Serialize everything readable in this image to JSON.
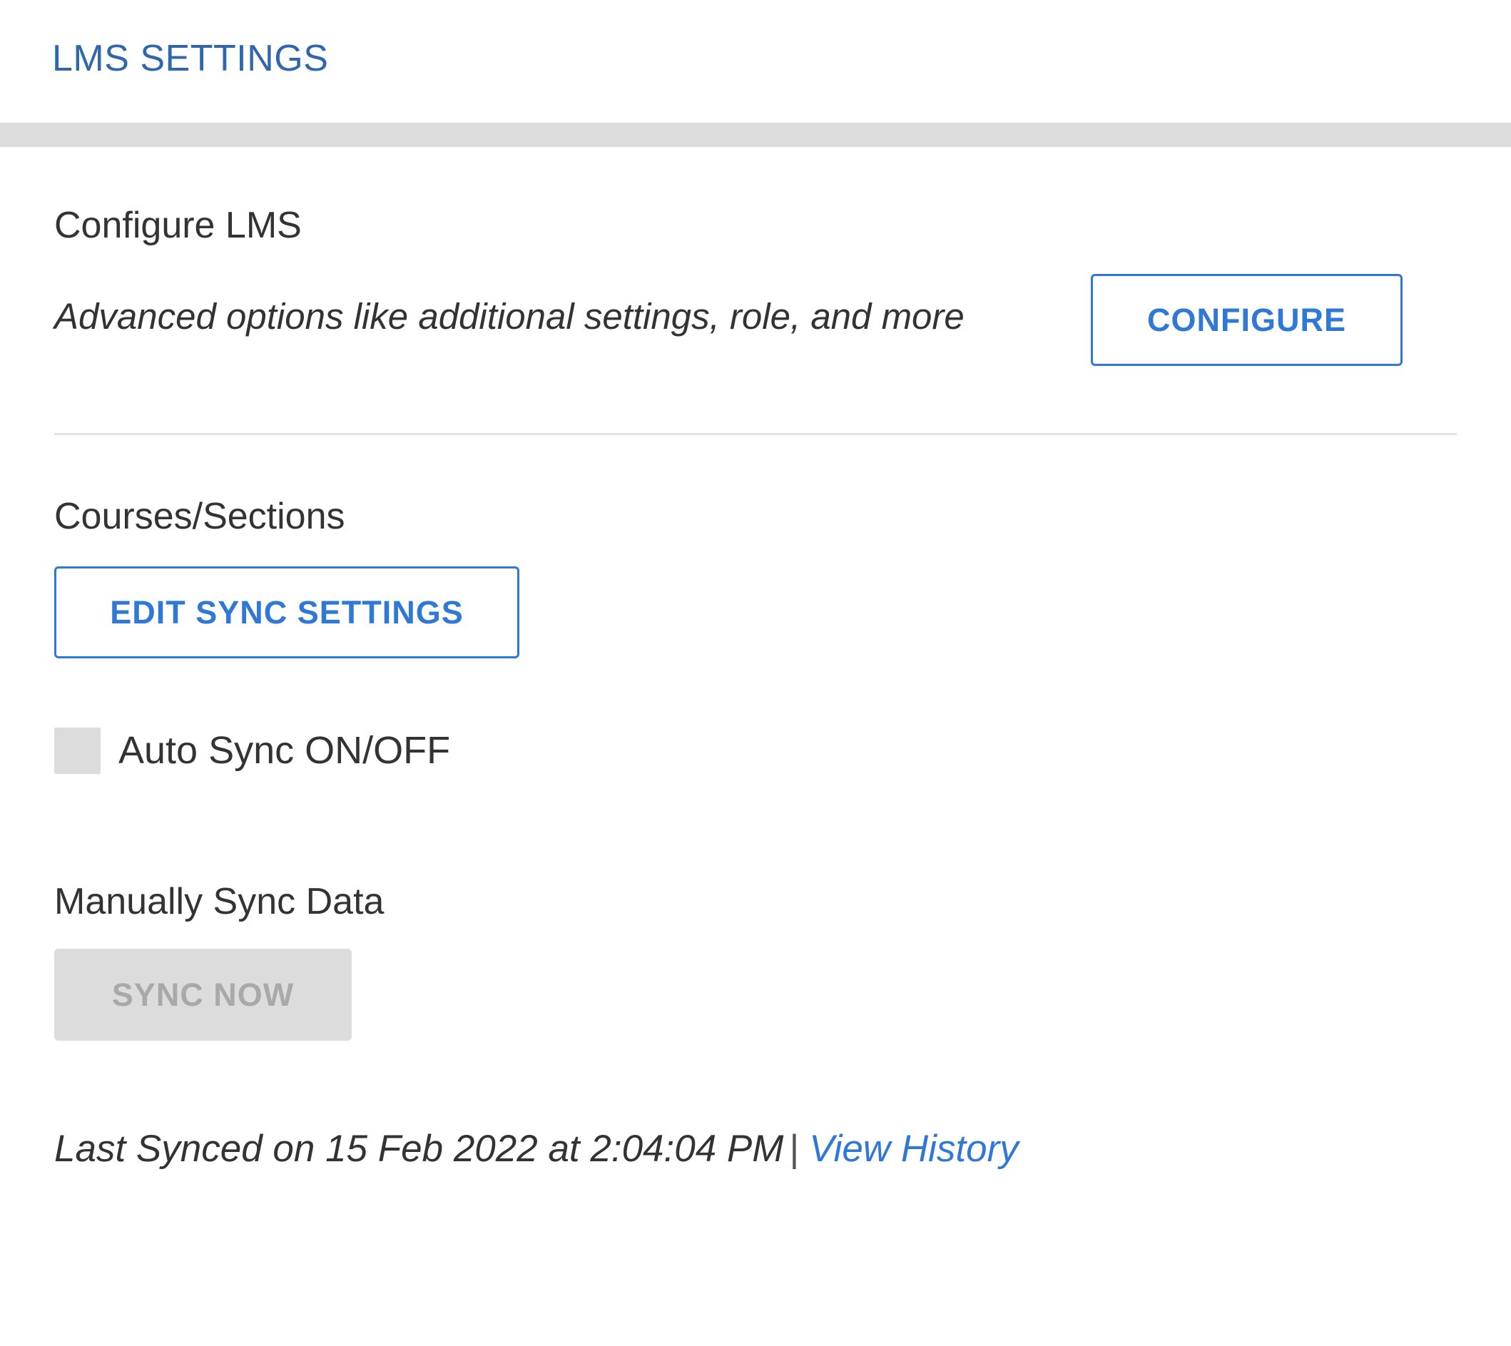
{
  "header": {
    "title": "LMS SETTINGS"
  },
  "configure_section": {
    "label": "Configure LMS",
    "description": "Advanced options like additional settings, role, and more",
    "button_label": "CONFIGURE"
  },
  "courses_section": {
    "label": "Courses/Sections",
    "button_label": "EDIT SYNC SETTINGS",
    "auto_sync": {
      "label": "Auto Sync ON/OFF",
      "checked": false
    }
  },
  "manual_sync_section": {
    "label": "Manually Sync Data",
    "button_label": "SYNC NOW",
    "button_state": "disabled"
  },
  "sync_status": {
    "last_synced_text": "Last Synced on 15 Feb 2022 at 2:04:04 PM",
    "separator": "|",
    "history_link": "View History"
  },
  "colors": {
    "header_title": "#2f66ad",
    "accent": "#2f78d6",
    "disabled_bg": "#dcdcdc",
    "disabled_text": "#a9a9a9",
    "text": "#333333"
  }
}
